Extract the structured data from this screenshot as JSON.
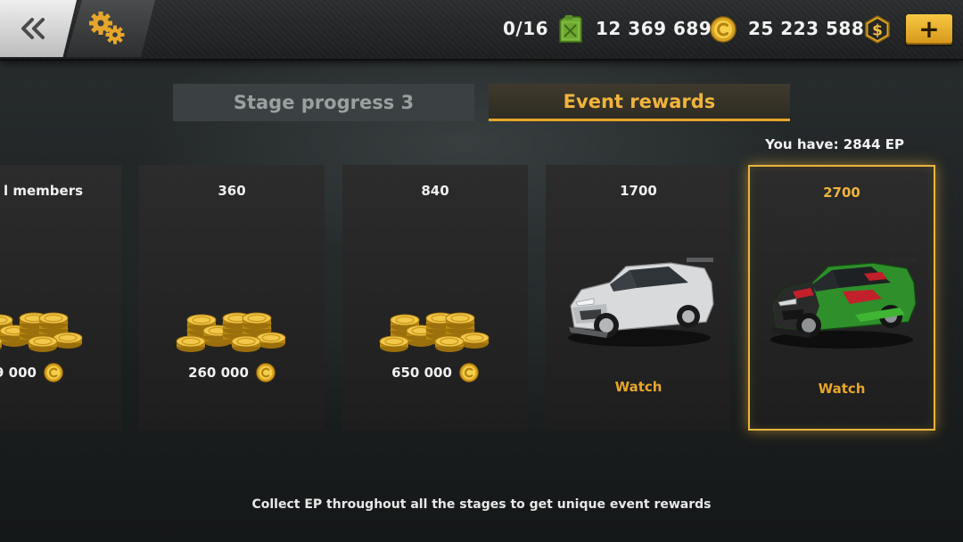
{
  "topbar": {
    "fuel_count": "0/16",
    "coins": "12 369 689",
    "cash": "25 223 588",
    "add_label": "+"
  },
  "tabs": [
    {
      "label": "Stage progress 3",
      "active": false
    },
    {
      "label": "Event rewards",
      "active": true
    }
  ],
  "ep_balance": "You have: 2844 EP",
  "rewards": [
    {
      "cost": "l members",
      "amount": "9 000",
      "type": "coins"
    },
    {
      "cost": "360",
      "amount": "260 000",
      "type": "coins"
    },
    {
      "cost": "840",
      "amount": "650 000",
      "type": "coins"
    },
    {
      "cost": "1700",
      "action": "Watch",
      "type": "car",
      "car_color": "white"
    },
    {
      "cost": "2700",
      "action": "Watch",
      "type": "car",
      "car_color": "green",
      "selected": true
    }
  ],
  "footer_hint": "Collect EP throughout all the stages to get unique event rewards",
  "colors": {
    "accent_gold": "#e6a62a",
    "tab_inactive_bg": "#3b4142",
    "card_bg": "#262626"
  }
}
